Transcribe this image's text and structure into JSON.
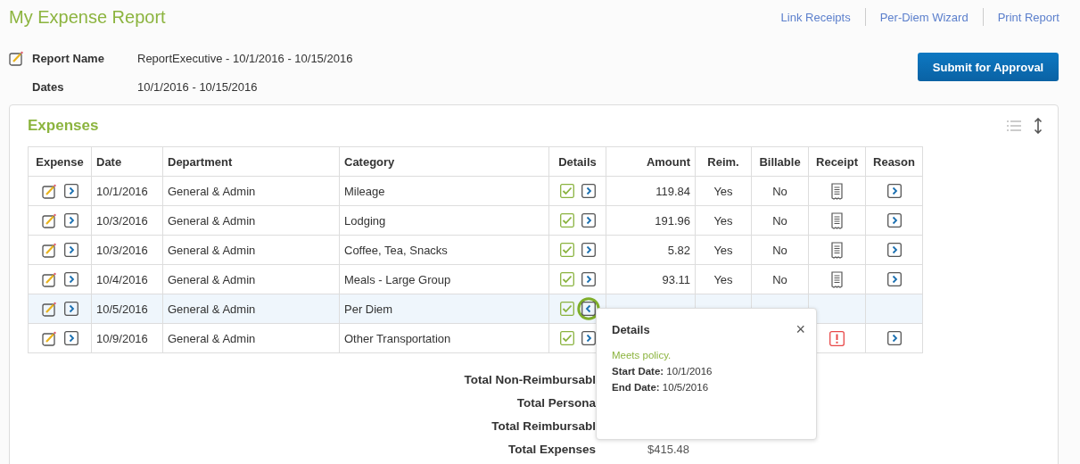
{
  "title": "My Expense Report",
  "links": [
    "Link Receipts",
    "Per-Diem Wizard",
    "Print Report"
  ],
  "report": [
    {
      "label": "Report Name",
      "value": "ReportExecutive - 10/1/2016 - 10/15/2016",
      "editable": true
    },
    {
      "label": "Dates",
      "value": "10/1/2016 - 10/15/2016",
      "editable": false
    }
  ],
  "submit_button": "Submit for Approval",
  "expenses": {
    "title": "Expenses",
    "columns": [
      "Expense",
      "Date",
      "Department",
      "Category",
      "Details",
      "Amount",
      "Reim.",
      "Billable",
      "Receipt",
      "Reason"
    ],
    "rows": [
      {
        "date": "10/1/2016",
        "department": "General & Admin",
        "category": "Mileage",
        "meets_policy": true,
        "expanded": false,
        "selected": false,
        "amount": "119.84",
        "reim": "Yes",
        "billable": "No",
        "has_receipt": true,
        "receipt_missing": false,
        "reason": true
      },
      {
        "date": "10/3/2016",
        "department": "General & Admin",
        "category": "Lodging",
        "meets_policy": true,
        "expanded": false,
        "selected": false,
        "amount": "191.96",
        "reim": "Yes",
        "billable": "No",
        "has_receipt": true,
        "receipt_missing": false,
        "reason": true
      },
      {
        "date": "10/3/2016",
        "department": "General & Admin",
        "category": "Coffee, Tea, Snacks",
        "meets_policy": true,
        "expanded": false,
        "selected": false,
        "amount": "5.82",
        "reim": "Yes",
        "billable": "No",
        "has_receipt": true,
        "receipt_missing": false,
        "reason": true
      },
      {
        "date": "10/4/2016",
        "department": "General & Admin",
        "category": "Meals - Large Group",
        "meets_policy": true,
        "expanded": false,
        "selected": false,
        "amount": "93.11",
        "reim": "Yes",
        "billable": "No",
        "has_receipt": true,
        "receipt_missing": false,
        "reason": true
      },
      {
        "date": "10/5/2016",
        "department": "General & Admin",
        "category": "Per Diem",
        "meets_policy": true,
        "expanded": true,
        "selected": true,
        "has_receipt": false,
        "receipt_missing": false,
        "reason": false
      },
      {
        "date": "10/9/2016",
        "department": "General & Admin",
        "category": "Other Transportation",
        "meets_policy": true,
        "expanded": false,
        "selected": false,
        "has_receipt": false,
        "receipt_missing": true,
        "reason": true
      }
    ],
    "totals": [
      {
        "label": "Total Non-Reimbursabl"
      },
      {
        "label": "Total Persona"
      },
      {
        "label": "Total Reimbursabl"
      },
      {
        "label": "Total Expenses",
        "value": "$415.48"
      }
    ]
  },
  "details_popover": {
    "title": "Details",
    "close": "×",
    "status": "Meets policy.",
    "lines": [
      {
        "label": "Start Date:",
        "value": "10/1/2016"
      },
      {
        "label": "End Date:",
        "value": "10/5/2016"
      }
    ]
  }
}
